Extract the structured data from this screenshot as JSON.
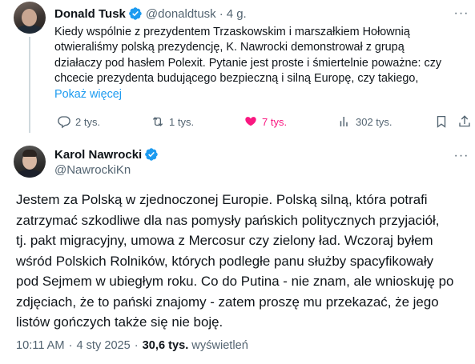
{
  "tweet1": {
    "author_name": "Donald Tusk",
    "handle": "@donaldtusk",
    "separator": "·",
    "time": "4 g.",
    "more_icon": "···",
    "text_lines": [
      "Kiedy wspólnie z prezydentem Trzaskowskim i marszałkiem Hołownią",
      "otwieraliśmy polską prezydencję, K. Nawrocki demonstrował z grupą",
      "działaczy pod hasłem Polexit. Pytanie jest proste i śmiertelnie poważne: czy",
      "chcecie prezydenta budującego bezpieczną i silną Europę, czy takiego,"
    ],
    "show_more": "Pokaż więcej",
    "actions": {
      "replies": "2 tys.",
      "reposts": "1 tys.",
      "likes": "7 tys.",
      "views": "302 tys."
    }
  },
  "tweet2": {
    "author_name": "Karol Nawrocki",
    "handle": "@NawrockiKn",
    "more_icon": "···",
    "text_lines": [
      "Jestem za Polską w zjednoczonej Europie. Polską silną, która potrafi",
      "zatrzymać szkodliwe dla nas pomysły pańskich politycznych przyjaciół,",
      "tj. pakt migracyjny, umowa z Mercosur czy zielony ład. Wczoraj byłem",
      "wśród Polskich Rolników, których podległe panu służby spacyfikowały",
      "pod Sejmem w ubiegłym roku. Co do Putina - nie znam, ale wnioskuję po",
      "zdjęciach, że to pański znajomy - zatem proszę mu przekazać, że jego",
      "listów gończych także się nie boję."
    ],
    "meta": {
      "time": "10:11 AM",
      "separator": "·",
      "date": "4 sty 2025",
      "views_count": "30,6 tys.",
      "views_label": "wyświetleń"
    }
  },
  "colors": {
    "accent": "#1d9bf0",
    "like": "#f91880",
    "secondary_text": "#536471",
    "primary_text": "#0f1419",
    "thread_line": "#cfd9de"
  },
  "icons": [
    "verified-badge-icon",
    "reply-icon",
    "repost-icon",
    "heart-icon",
    "views-icon",
    "bookmark-icon",
    "share-icon",
    "more-icon"
  ]
}
